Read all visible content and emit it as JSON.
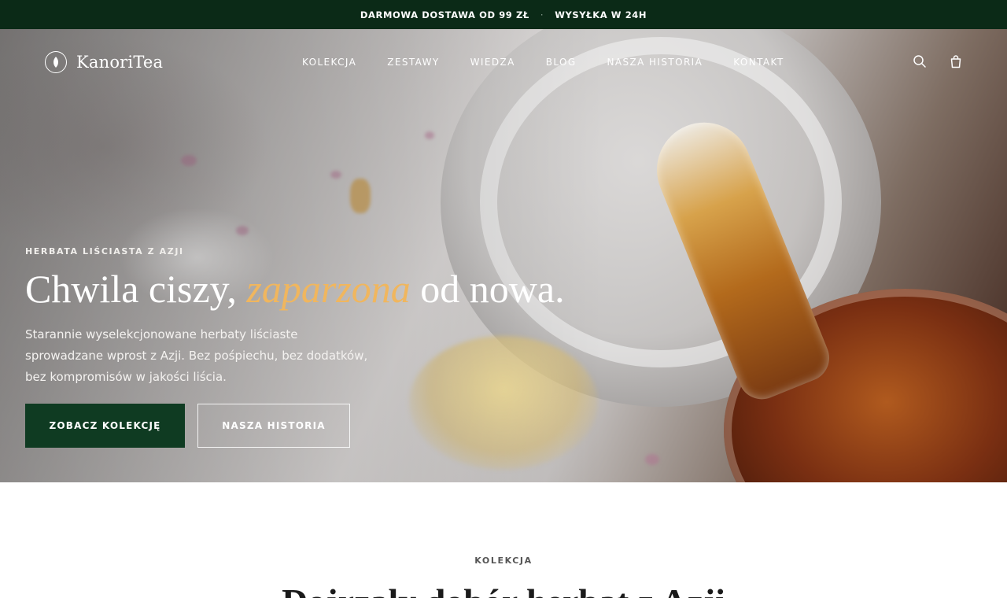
{
  "announcement": {
    "left": "DARMOWA DOSTAWA OD 99 ZŁ",
    "separator": "·",
    "right": "WYSYŁKA W 24H"
  },
  "header": {
    "logo": "KanoriTea",
    "nav": [
      "KOLEKCJA",
      "ZESTAWY",
      "WIEDZA",
      "BLOG",
      "NASZA HISTORIA",
      "KONTAKT"
    ],
    "icons": [
      "search-icon",
      "shopping-bag-icon"
    ]
  },
  "hero": {
    "eyebrow": "HERBATA LIŚCIASTA Z AZJI",
    "title_start": "Chwila ciszy,",
    "title_accent": "zaparzona",
    "title_end": "od nowa.",
    "subtitle": "Starannie wyselekcjonowane herbaty liściaste sprowadzane wprost z Azji. Bez pośpiechu, bez dodatków, bez kompromisów w jakości liścia.",
    "primary_button": "ZOBACZ KOLEKCJĘ",
    "secondary_button": "NASZA HISTORIA",
    "accent_color": "#f0b65e"
  },
  "collection": {
    "eyebrow": "KOLEKCJA",
    "title": "Dojrzały dobór herbat z Azji"
  },
  "colors": {
    "topbar": "#0b2a17",
    "primary_button": "#0f3b22"
  }
}
